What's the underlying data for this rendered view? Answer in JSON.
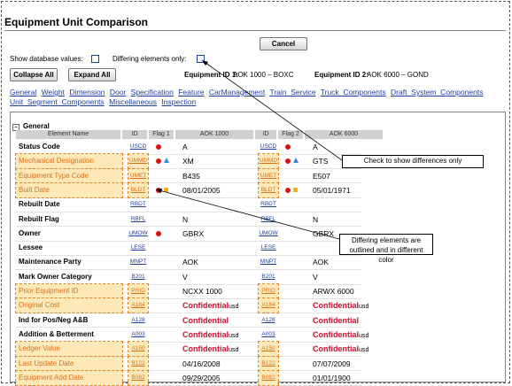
{
  "title": "Equipment Unit Comparison",
  "buttons": {
    "cancel": "Cancel",
    "collapse_all": "Collapse All",
    "expand_all": "Expand All"
  },
  "options": {
    "show_db_values": "Show database values:",
    "differing_only": "Differing elements only:"
  },
  "equipment": {
    "id1_label": "Equipment ID 1:",
    "id1_value": "AOK 1000 – BOXC",
    "id2_label": "Equipment ID 2:",
    "id2_value": "AOK 6000 – GOND"
  },
  "nav_links": [
    "General",
    "Weight",
    "Dimension",
    "Door",
    "Specification",
    "Feature",
    "CarManagement",
    "Train_Service",
    "Truck_Components",
    "Draft_System_Components",
    "Unit_Segment_Components",
    "Miscellaneous",
    "Inspection"
  ],
  "section": {
    "toggle": "–",
    "label": "General"
  },
  "columns": [
    "Element Name",
    "ID",
    "Flag 1",
    "AOK 1000",
    "ID",
    "Flag 2",
    "AOK 6000"
  ],
  "rows": [
    {
      "name": "Status Code",
      "id1": "USCD",
      "flag1": [
        "dot"
      ],
      "v1": "A",
      "id2": "USCD",
      "flag2": [
        "dot"
      ],
      "v2": "A",
      "diff": false,
      "conf": false
    },
    {
      "name": "Mechanical Designation",
      "id1": "UMMD",
      "flag1": [
        "dot",
        "tri"
      ],
      "v1": "XM",
      "id2": "UMMD",
      "flag2": [
        "dot",
        "tri"
      ],
      "v2": "GTS",
      "diff": true,
      "conf": false
    },
    {
      "name": "Equipment Type Code",
      "id1": "UMET",
      "flag1": [],
      "v1": "B435",
      "id2": "UMET",
      "flag2": [],
      "v2": "E507",
      "diff": true,
      "conf": false
    },
    {
      "name": "Built Date",
      "id1": "BLDT",
      "flag1": [
        "dot",
        "sq"
      ],
      "v1": "08/01/2005",
      "id2": "BLDT",
      "flag2": [
        "dot",
        "sq"
      ],
      "v2": "05/01/1971",
      "diff": true,
      "conf": false
    },
    {
      "name": "Rebuilt Date",
      "id1": "RBDT",
      "flag1": [],
      "v1": "",
      "id2": "RBDT",
      "flag2": [],
      "v2": "",
      "diff": false,
      "conf": false
    },
    {
      "name": "Rebuilt Flag",
      "id1": "RBFL",
      "flag1": [],
      "v1": "N",
      "id2": "RBFL",
      "flag2": [],
      "v2": "N",
      "diff": false,
      "conf": false
    },
    {
      "name": "Owner",
      "id1": "UMOW",
      "flag1": [
        "dot"
      ],
      "v1": "GBRX",
      "id2": "UMOW",
      "flag2": [],
      "v2": "GBRX",
      "diff": false,
      "conf": false
    },
    {
      "name": "Lessee",
      "id1": "LESE",
      "flag1": [],
      "v1": "",
      "id2": "LESE",
      "flag2": [],
      "v2": "",
      "diff": false,
      "conf": false
    },
    {
      "name": "Maintenance Party",
      "id1": "MNPT",
      "flag1": [],
      "v1": "AOK",
      "id2": "MNPT",
      "flag2": [],
      "v2": "AOK",
      "diff": false,
      "conf": false
    },
    {
      "name": "Mark Owner Category",
      "id1": "B201",
      "flag1": [],
      "v1": "V",
      "id2": "B201",
      "flag2": [],
      "v2": "V",
      "diff": false,
      "conf": false
    },
    {
      "name": "Prior Equipment ID",
      "id1": "PRID",
      "flag1": [],
      "v1": "NCXX 1000",
      "id2": "PRID",
      "flag2": [],
      "v2": "ARWX 6000",
      "diff": true,
      "conf": false
    },
    {
      "name": "Original Cost",
      "id1": "A184",
      "flag1": [],
      "v1": "Confidential",
      "id2": "A184",
      "flag2": [],
      "v2": "Confidential",
      "diff": true,
      "conf": true
    },
    {
      "name": "Ind for Pos/Neg A&B",
      "id1": "A128",
      "flag1": [],
      "v1": "Confidential",
      "id2": "A128",
      "flag2": [],
      "v2": "Confidential",
      "diff": false,
      "conf": true,
      "nousd": true
    },
    {
      "name": "Addition & Betterment",
      "id1": "A003",
      "flag1": [],
      "v1": "Confidential",
      "id2": "A003",
      "flag2": [],
      "v2": "Confidential",
      "diff": false,
      "conf": true
    },
    {
      "name": "Ledger Value",
      "id1": "A150",
      "flag1": [],
      "v1": "Confidential",
      "id2": "A150",
      "flag2": [],
      "v2": "Confidential",
      "diff": true,
      "conf": true
    },
    {
      "name": "Last Update Date",
      "id1": "B122",
      "flag1": [],
      "v1": "04/16/2008",
      "id2": "B122",
      "flag2": [],
      "v2": "07/07/2009",
      "diff": true,
      "conf": false
    },
    {
      "name": "Equipment Add Date",
      "id1": "B082",
      "flag1": [],
      "v1": "09/29/2005",
      "id2": "B082",
      "flag2": [],
      "v2": "01/01/1900",
      "diff": true,
      "conf": false
    }
  ],
  "usd_label": "usd",
  "callouts": {
    "differences": "Check to show differences only",
    "outlined": "Differing elements are outlined and in different color"
  },
  "colors": {
    "link": "#1f3f9c",
    "confidential": "#c8102e",
    "diff_text": "#d9701a",
    "diff_bg": "#fde9b8"
  }
}
